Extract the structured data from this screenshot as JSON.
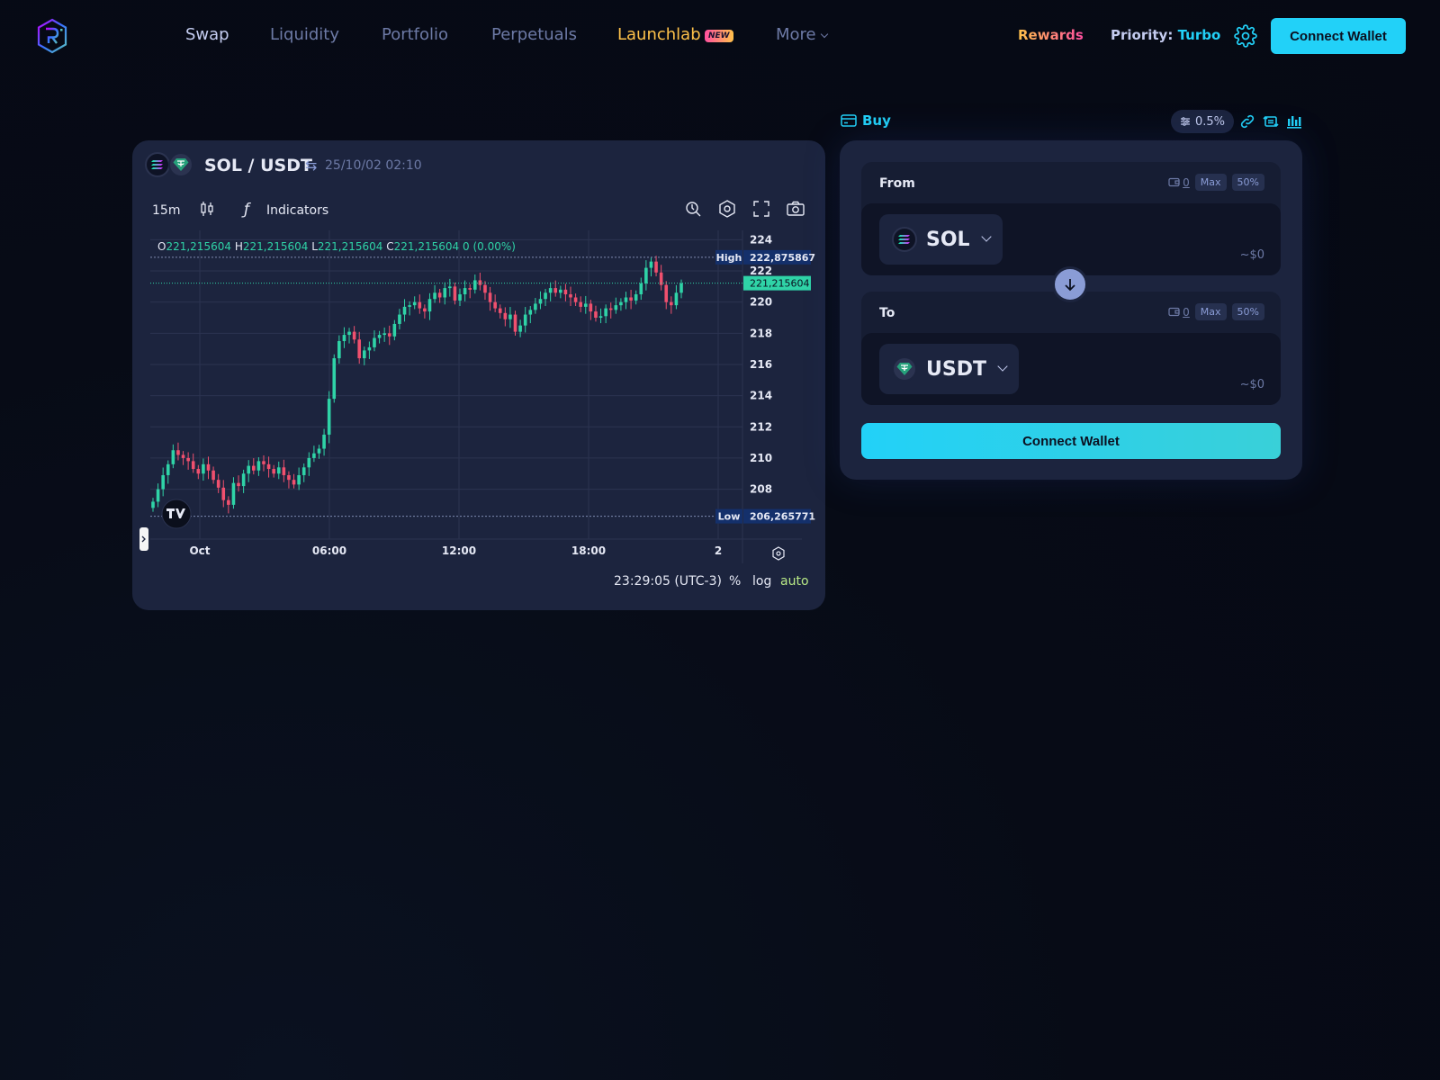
{
  "nav": {
    "items": [
      {
        "label": "Swap",
        "active": true
      },
      {
        "label": "Liquidity"
      },
      {
        "label": "Portfolio"
      },
      {
        "label": "Perpetuals"
      },
      {
        "label": "Launchlab",
        "badge": "NEW"
      },
      {
        "label": "More"
      }
    ],
    "rewards": "Rewards",
    "priority_label": "Priority:",
    "priority_value": "Turbo",
    "connect": "Connect Wallet",
    "icons": [
      "raydium-logo",
      "gear-icon",
      "chevron-down-icon"
    ]
  },
  "chart": {
    "pair": "SOL / USDT",
    "timestamp": "25/10/02 02:10",
    "interval": "15m",
    "indicators": "Indicators",
    "ohlc": {
      "o": "221,215604",
      "h": "221,215604",
      "l": "221,215604",
      "c": "221,215604",
      "change": "0 (0.00%)"
    },
    "high_label": "High",
    "high_value": "222,875867",
    "low_label": "Low",
    "low_value": "206,265771",
    "last_value": "221,215604",
    "footer_time": "23:29:05 (UTC-3)",
    "footer_opts": [
      "%",
      "log",
      "auto"
    ],
    "colors": {
      "up": "#2fd3a7",
      "down": "#f0506e",
      "grid": "#2b3350"
    }
  },
  "chart_data": {
    "type": "candlestick",
    "title": "SOL / USDT",
    "y_ticks": [
      224,
      222,
      220,
      218,
      216,
      214,
      212,
      210,
      208
    ],
    "x_ticks": [
      "Oct",
      "06:00",
      "12:00",
      "18:00",
      "2"
    ],
    "ylim": [
      205,
      225
    ],
    "high": 222.875867,
    "low": 206.265771,
    "last": 221.215604,
    "grid": true,
    "closes": [
      207.2,
      208.0,
      208.9,
      209.6,
      210.5,
      210.2,
      210.0,
      209.8,
      209.3,
      209.0,
      209.6,
      209.2,
      208.6,
      208.1,
      207.3,
      207.0,
      208.4,
      208.2,
      209.0,
      209.5,
      209.2,
      209.8,
      209.6,
      209.3,
      209.0,
      209.4,
      208.9,
      208.6,
      208.3,
      208.9,
      209.4,
      210.0,
      210.3,
      210.6,
      211.5,
      213.8,
      216.4,
      217.5,
      217.9,
      218.1,
      217.6,
      216.4,
      216.9,
      217.1,
      217.7,
      217.9,
      218.0,
      217.8,
      218.6,
      219.2,
      219.7,
      219.8,
      220.0,
      219.6,
      219.4,
      220.2,
      220.6,
      220.3,
      220.9,
      221.0,
      220.1,
      220.5,
      220.9,
      220.8,
      221.4,
      221.1,
      220.6,
      220.0,
      219.6,
      219.3,
      218.9,
      219.2,
      218.1,
      218.5,
      219.2,
      219.5,
      219.9,
      220.2,
      220.6,
      220.9,
      220.6,
      220.8,
      220.5,
      220.3,
      220.0,
      219.7,
      219.9,
      219.4,
      219.0,
      219.1,
      219.6,
      219.5,
      219.8,
      220.0,
      220.3,
      220.1,
      220.5,
      221.2,
      222.2,
      222.6,
      221.9,
      221.1,
      220.0,
      219.8,
      220.6,
      221.2
    ]
  },
  "swap": {
    "buy": "Buy",
    "slippage": "0.5%",
    "from": {
      "label": "From",
      "balance": "0",
      "max": "Max",
      "half": "50%",
      "token": "SOL",
      "usd": "~$0"
    },
    "to": {
      "label": "To",
      "balance": "0",
      "max": "Max",
      "half": "50%",
      "token": "USDT",
      "usd": "~$0"
    },
    "connect": "Connect Wallet"
  }
}
